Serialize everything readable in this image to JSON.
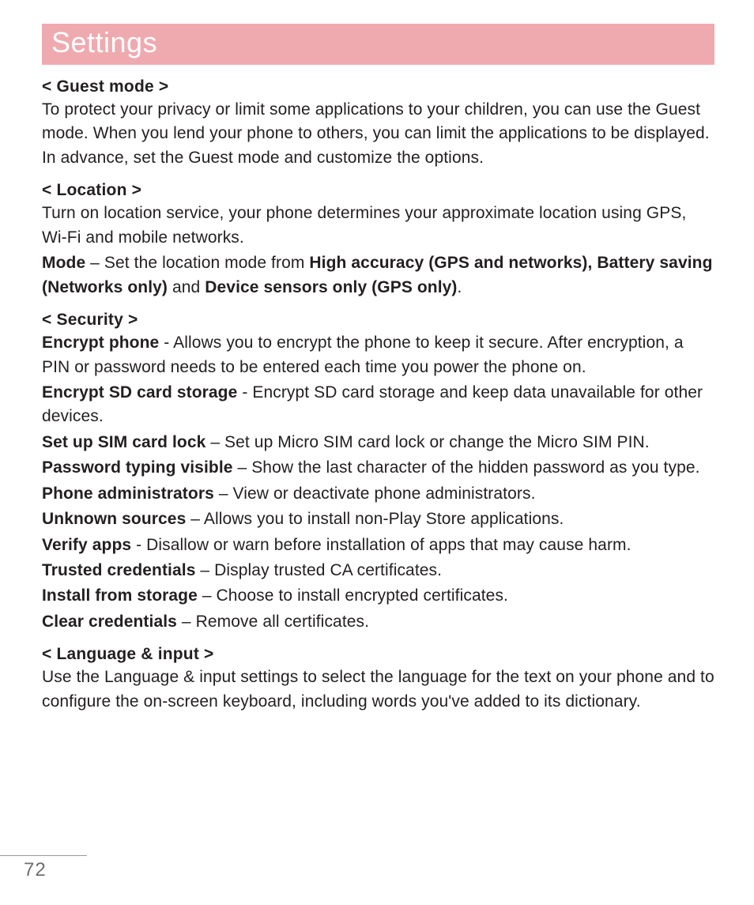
{
  "title": "Settings",
  "pageNumber": "72",
  "sections": {
    "guest": {
      "head": "< Guest mode >",
      "body": "To protect your privacy or limit some applications to your children, you can use the Guest mode. When you lend your phone to others, you can limit the applications to be displayed. In advance, set the Guest mode and customize the options."
    },
    "location": {
      "head": "< Location >",
      "body1": "Turn on location service, your phone determines your approximate location using GPS, Wi-Fi and mobile networks.",
      "mode_label": "Mode",
      "mode_sep": " – Set the location mode from ",
      "mode_opt1": "High accuracy (GPS and networks), Battery saving (Networks only)",
      "mode_and": " and ",
      "mode_opt2": "Device sensors only (GPS only)",
      "mode_end": "."
    },
    "security": {
      "head": "< Security >",
      "items": [
        {
          "term": "Encrypt phone",
          "desc": " - Allows you to encrypt the phone to keep it secure. After encryption, a PIN or password needs to be entered each time you power the phone on."
        },
        {
          "term": "Encrypt SD card storage",
          "desc": " - Encrypt SD card storage and keep data unavailable for other devices."
        },
        {
          "term": "Set up SIM card lock",
          "desc": " – Set up Micro SIM card lock or change the Micro SIM PIN."
        },
        {
          "term": "Password typing visible",
          "desc": " – Show the last character of the hidden password as you type."
        },
        {
          "term": "Phone administrators",
          "desc": " – View or deactivate phone administrators."
        },
        {
          "term": "Unknown sources",
          "desc": " – Allows you to install non-Play Store applications."
        },
        {
          "term": "Verify apps",
          "desc": " - Disallow or warn before installation of apps that may cause harm."
        },
        {
          "term": "Trusted credentials",
          "desc": " – Display trusted CA certificates."
        },
        {
          "term": "Install from storage",
          "desc": " – Choose to install encrypted certificates."
        },
        {
          "term": "Clear credentials",
          "desc": " – Remove all certificates."
        }
      ]
    },
    "lang": {
      "head": "< Language & input >",
      "body": "Use the Language & input settings to select the language for the text on your phone and to configure the on-screen keyboard, including words you've added to its dictionary."
    }
  }
}
